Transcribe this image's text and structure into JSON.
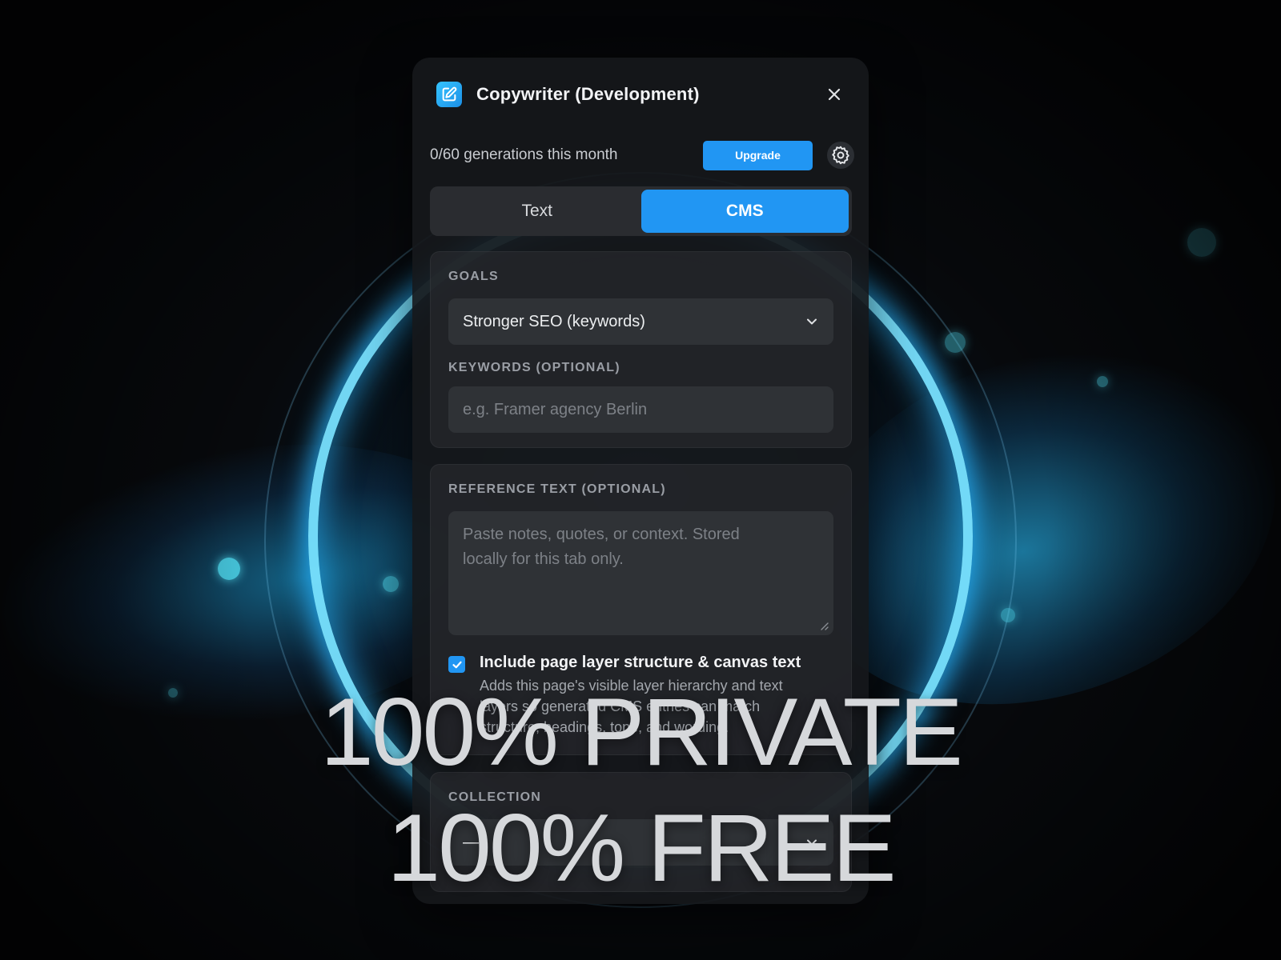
{
  "window": {
    "title": "Copywriter (Development)"
  },
  "usage": {
    "text": "0/60 generations this month",
    "upgrade_label": "Upgrade"
  },
  "tabs": [
    {
      "label": "Text",
      "active": false
    },
    {
      "label": "CMS",
      "active": true
    }
  ],
  "goals": {
    "label": "GOALS",
    "selected": "Stronger SEO (keywords)"
  },
  "keywords": {
    "label": "KEYWORDS (OPTIONAL)",
    "placeholder": "e.g. Framer agency Berlin"
  },
  "reference": {
    "label": "REFERENCE TEXT (OPTIONAL)",
    "placeholder_line1": "Paste notes, quotes, or context. Stored",
    "placeholder_line2": "locally for this tab only."
  },
  "include_structure": {
    "checked": true,
    "title": "Include page layer structure & canvas text",
    "description": "Adds this page's visible layer hierarchy and text layers so generated CMS entries can match structure, headings, tone, and wording."
  },
  "collection": {
    "label": "COLLECTION",
    "selected": "—"
  },
  "promo": {
    "line1": "100% PRIVATE",
    "line2": "100% FREE"
  },
  "colors": {
    "accent": "#2196f3",
    "panel_bg": "#16181b",
    "ring_glow": "#28b4ff"
  },
  "icons": {
    "app": "edit-square-icon",
    "close": "close-icon",
    "settings": "gear-icon",
    "select": "chevron-down-icon",
    "check": "checkmark-icon"
  }
}
